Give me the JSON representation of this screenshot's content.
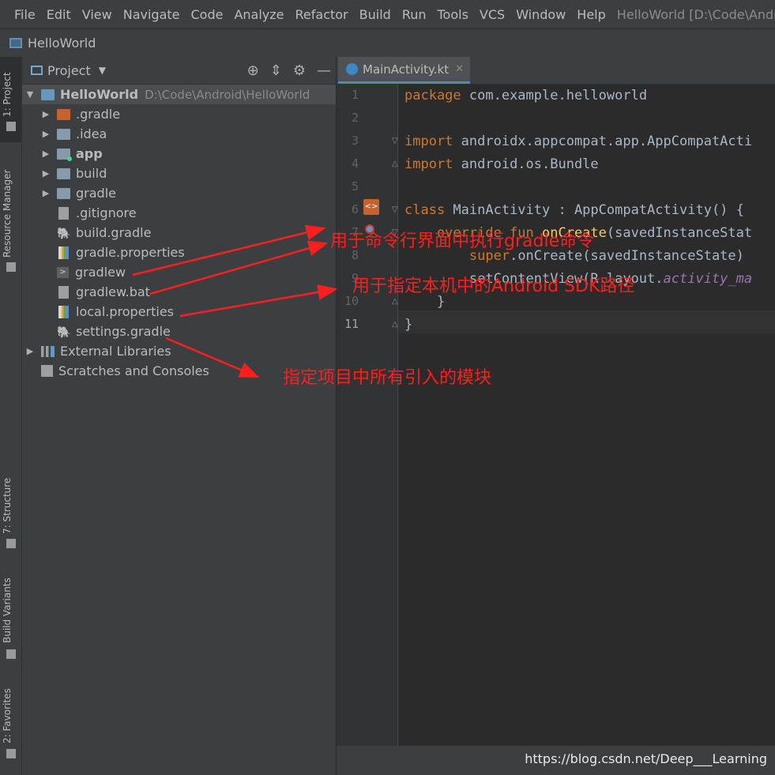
{
  "menubar": {
    "items": [
      "File",
      "Edit",
      "View",
      "Navigate",
      "Code",
      "Analyze",
      "Refactor",
      "Build",
      "Run",
      "Tools",
      "VCS",
      "Window",
      "Help"
    ],
    "window_title": "HelloWorld [D:\\Code\\Andr"
  },
  "navbar": {
    "project": "HelloWorld"
  },
  "left_strip": {
    "tabs": [
      "1: Project",
      "Resource Manager",
      "7: Structure",
      "Build Variants",
      "2: Favorites"
    ]
  },
  "project_panel": {
    "title": "Project",
    "root": {
      "name": "HelloWorld",
      "path": "D:\\Code\\Android\\HelloWorld"
    },
    "items": [
      {
        "label": ".gradle",
        "icon": "folder-orange-icon",
        "expandable": true
      },
      {
        "label": ".idea",
        "icon": "folder-icon",
        "expandable": true
      },
      {
        "label": "app",
        "icon": "module-folder-icon",
        "expandable": true,
        "bold": true
      },
      {
        "label": "build",
        "icon": "folder-icon",
        "expandable": true
      },
      {
        "label": "gradle",
        "icon": "folder-icon",
        "expandable": true
      },
      {
        "label": ".gitignore",
        "icon": "file-icon",
        "expandable": false
      },
      {
        "label": "build.gradle",
        "icon": "gradle-icon",
        "expandable": false
      },
      {
        "label": "gradle.properties",
        "icon": "properties-icon",
        "expandable": false
      },
      {
        "label": "gradlew",
        "icon": "terminal-icon",
        "expandable": false
      },
      {
        "label": "gradlew.bat",
        "icon": "file-icon",
        "expandable": false
      },
      {
        "label": "local.properties",
        "icon": "properties-icon",
        "expandable": false
      },
      {
        "label": "settings.gradle",
        "icon": "gradle-icon",
        "expandable": false
      }
    ],
    "external_libraries": "External Libraries",
    "scratches": "Scratches and Consoles"
  },
  "editor": {
    "tab": "MainActivity.kt",
    "line_numbers": [
      "1",
      "2",
      "3",
      "4",
      "5",
      "6",
      "7",
      "8",
      "9",
      "10",
      "11"
    ],
    "current_line": 11,
    "lines": [
      [
        {
          "t": "package",
          "c": "kw"
        },
        {
          "t": " com.example.helloworld",
          "c": "pl"
        }
      ],
      [],
      [
        {
          "t": "import",
          "c": "kw"
        },
        {
          "t": " androidx.appcompat.app.AppCompatActi",
          "c": "pl"
        }
      ],
      [
        {
          "t": "import",
          "c": "kw"
        },
        {
          "t": " android.os.Bundle",
          "c": "pl"
        }
      ],
      [],
      [
        {
          "t": "class",
          "c": "kw"
        },
        {
          "t": " MainActivity : AppCompatActivity() {",
          "c": "pl"
        }
      ],
      [
        {
          "t": "    override fun ",
          "c": "kw"
        },
        {
          "t": "onCreate",
          "c": "fn"
        },
        {
          "t": "(savedInstanceStat",
          "c": "pl"
        }
      ],
      [
        {
          "t": "        ",
          "c": "pl"
        },
        {
          "t": "super",
          "c": "kw"
        },
        {
          "t": ".onCreate(savedInstanceState)",
          "c": "pl"
        }
      ],
      [
        {
          "t": "        setContentView(R.layout.",
          "c": "pl"
        },
        {
          "t": "activity_ma",
          "c": "it"
        }
      ],
      [
        {
          "t": "    }",
          "c": "pl"
        }
      ],
      [
        {
          "t": "}",
          "c": "pl"
        }
      ]
    ]
  },
  "annotations": {
    "gradlew": "用于命令行界面中执行gradle命令",
    "local_properties": "用于指定本机中的Android SDK路径",
    "settings_gradle": "指定项目中所有引入的模块"
  },
  "watermark": "https://blog.csdn.net/Deep___Learning",
  "colors": {
    "annotation": "#ff1e1e",
    "keyword": "#cc7832",
    "function": "#ffc66d"
  }
}
